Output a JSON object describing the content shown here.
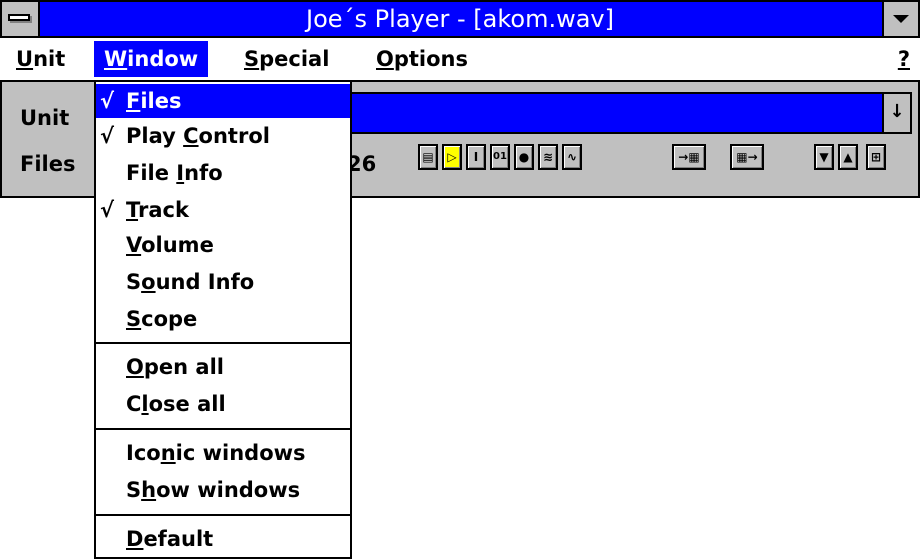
{
  "window": {
    "title": "Joe´s Player - [akom.wav]"
  },
  "menubar": {
    "items": [
      {
        "label_u": "U",
        "label_rest": "nit"
      },
      {
        "label_u": "W",
        "label_rest": "indow"
      },
      {
        "label_u": "S",
        "label_rest": "pecial"
      },
      {
        "label_u": "O",
        "label_rest": "ptions"
      }
    ],
    "help": "?"
  },
  "toolbar": {
    "unit_label": "Unit",
    "files_label": "Files",
    "files_value": "26",
    "drop_arrow": "↓",
    "button_icons": [
      "list-icon",
      "play-icon",
      "info-icon",
      "counter-icon",
      "record-icon",
      "wave-icon",
      "sine-icon",
      "move-to-list-icon",
      "move-from-list-icon",
      "down-arrow-icon",
      "up-arrow-icon",
      "grid-icon"
    ]
  },
  "window_menu": {
    "items": [
      {
        "pre": "",
        "u": "F",
        "post": "iles",
        "checked": true,
        "highlighted": true
      },
      {
        "pre": "Play ",
        "u": "C",
        "post": "ontrol",
        "checked": true
      },
      {
        "pre": "File ",
        "u": "I",
        "post": "nfo",
        "checked": false
      },
      {
        "pre": "",
        "u": "T",
        "post": "rack",
        "checked": true
      },
      {
        "pre": "",
        "u": "V",
        "post": "olume",
        "checked": false
      },
      {
        "pre": "S",
        "u": "o",
        "post": "und Info",
        "checked": false
      },
      {
        "pre": "",
        "u": "S",
        "post": "cope",
        "checked": false
      },
      {
        "pre": "",
        "u": "O",
        "post": "pen all",
        "checked": false
      },
      {
        "pre": "C",
        "u": "l",
        "post": "ose all",
        "checked": false
      },
      {
        "pre": "Ico",
        "u": "n",
        "post": "ic windows",
        "checked": false
      },
      {
        "pre": "S",
        "u": "h",
        "post": "ow windows",
        "checked": false
      },
      {
        "pre": "",
        "u": "D",
        "post": "efault",
        "checked": false
      }
    ],
    "check_mark": "√"
  },
  "colors": {
    "accent": "#0000ff",
    "chrome": "#c0c0c0",
    "play": "#ffff00"
  }
}
